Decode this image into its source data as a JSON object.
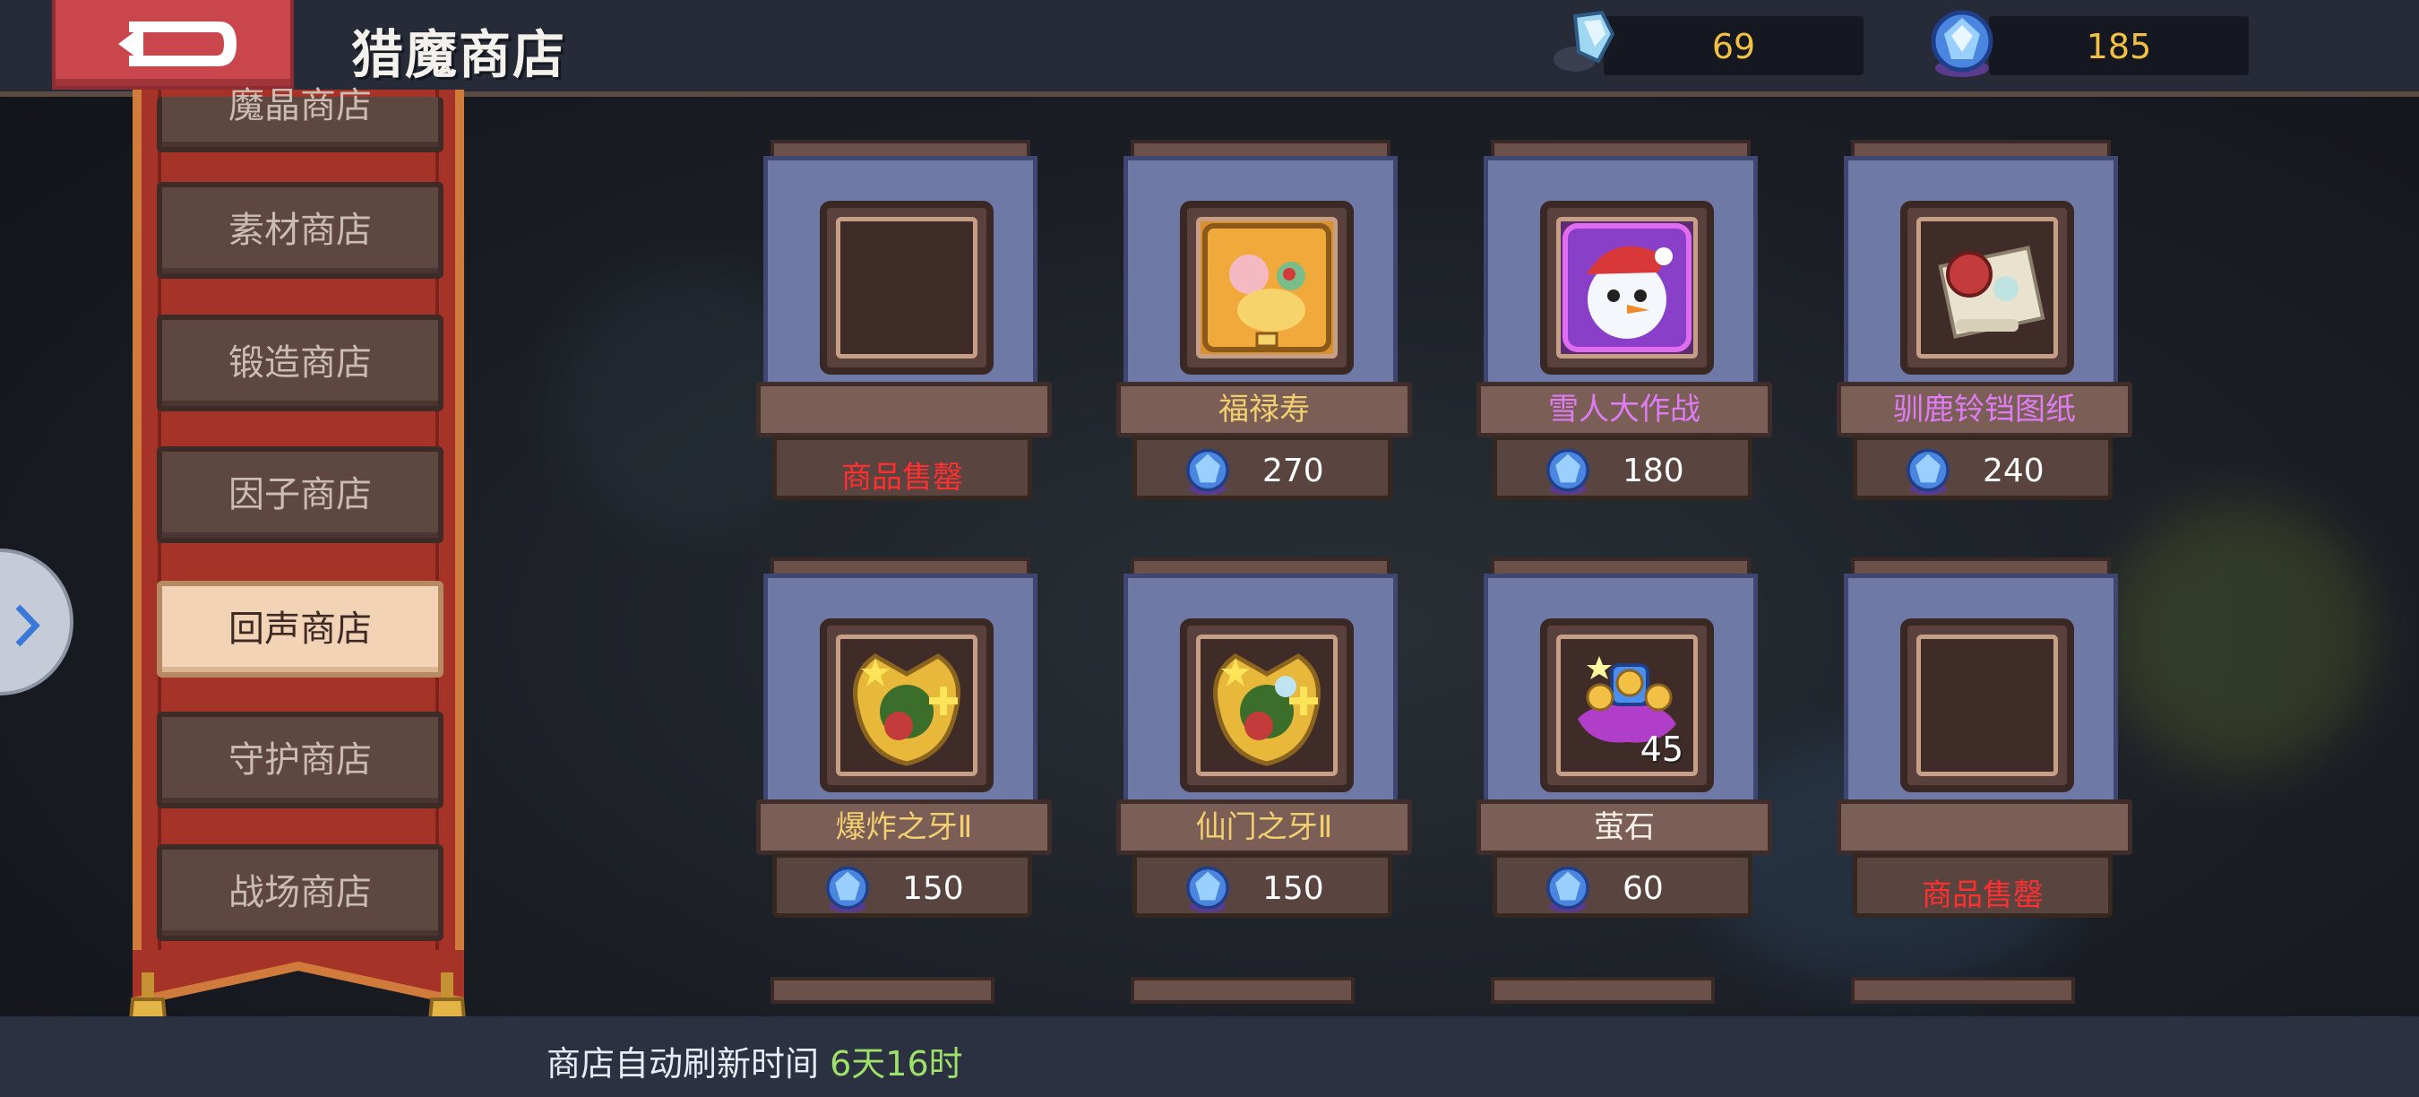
{
  "header": {
    "title": "猎魔商店",
    "currencies": [
      {
        "icon": "crystal-shard-icon",
        "value": "69"
      },
      {
        "icon": "blue-gem-icon",
        "value": "185"
      }
    ]
  },
  "sidebar": {
    "items": [
      {
        "label": "魔晶商店",
        "active": false
      },
      {
        "label": "素材商店",
        "active": false
      },
      {
        "label": "锻造商店",
        "active": false
      },
      {
        "label": "因子商店",
        "active": false
      },
      {
        "label": "回声商店",
        "active": true
      },
      {
        "label": "守护商店",
        "active": false
      },
      {
        "label": "战场商店",
        "active": false
      }
    ]
  },
  "shop_items": [
    {
      "name": "",
      "status": "商品售罄",
      "icon": "empty-slot"
    },
    {
      "name": "福禄寿",
      "price": "270",
      "icon": "fortune-treasure-icon"
    },
    {
      "name": "雪人大作战",
      "price": "180",
      "icon": "snowman-avatar-icon"
    },
    {
      "name": "驯鹿铃铛图纸",
      "price": "240",
      "icon": "reindeer-bell-blueprint-icon"
    },
    {
      "name": "爆炸之牙Ⅱ",
      "price": "150",
      "icon": "explosion-fang-badge-icon"
    },
    {
      "name": "仙门之牙Ⅱ",
      "price": "150",
      "icon": "immortal-gate-fang-badge-icon"
    },
    {
      "name": "萤石",
      "price": "60",
      "count": "45",
      "icon": "fluorite-gems-icon"
    },
    {
      "name": "",
      "status": "商品售罄",
      "icon": "empty-slot"
    }
  ],
  "footer": {
    "refresh_label": "商店自动刷新时间",
    "refresh_time": "6天16时"
  },
  "colors": {
    "gold_text": "#f2cf6f",
    "purple_text": "#de7cf4",
    "sold_out": "#ff2f2f",
    "refresh_time": "#9ee06a",
    "card_panel": "#6e79a6"
  }
}
